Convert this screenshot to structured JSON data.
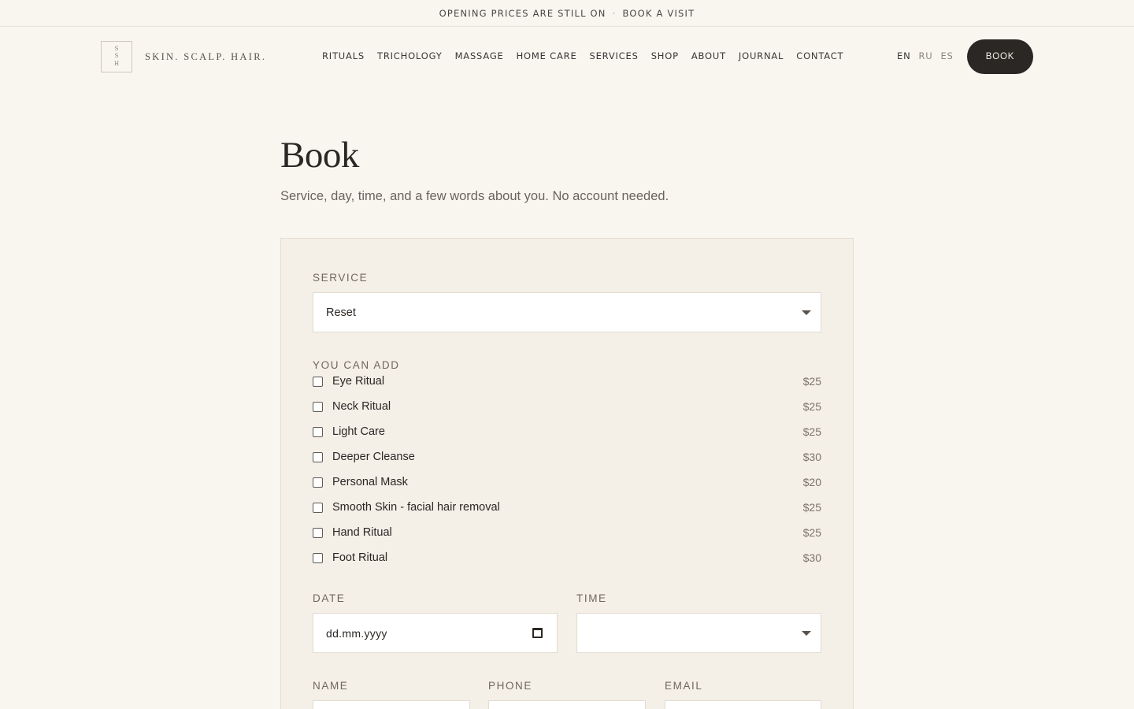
{
  "announcement": {
    "text": "OPENING PRICES ARE STILL ON",
    "separator": "·",
    "link": "BOOK A VISIT"
  },
  "brand": {
    "mark_lines": [
      "S",
      "S",
      "H"
    ],
    "name": "SKIN. SCALP. HAIR."
  },
  "nav": {
    "items": [
      "RITUALS",
      "TRICHOLOGY",
      "MASSAGE",
      "HOME CARE",
      "SERVICES",
      "SHOP",
      "ABOUT",
      "JOURNAL",
      "CONTACT"
    ]
  },
  "langs": {
    "items": [
      "EN",
      "RU",
      "ES"
    ],
    "active": "EN"
  },
  "header": {
    "book_label": "BOOK"
  },
  "page": {
    "title": "Book",
    "subtitle": "Service, day, time, and a few words about you. No account needed."
  },
  "form": {
    "service_label": "SERVICE",
    "service_value": "Reset",
    "addons_label": "YOU CAN ADD",
    "addons": [
      {
        "name": "Eye Ritual",
        "price": "$25",
        "checked": false
      },
      {
        "name": "Neck Ritual",
        "price": "$25",
        "checked": false
      },
      {
        "name": "Light Care",
        "price": "$25",
        "checked": false
      },
      {
        "name": "Deeper Cleanse",
        "price": "$30",
        "checked": false
      },
      {
        "name": "Personal Mask",
        "price": "$20",
        "checked": false
      },
      {
        "name": "Smooth Skin - facial hair removal",
        "price": "$25",
        "checked": false
      },
      {
        "name": "Hand Ritual",
        "price": "$25",
        "checked": false
      },
      {
        "name": "Foot Ritual",
        "price": "$30",
        "checked": false
      }
    ],
    "date_label": "DATE",
    "date_placeholder": "dd.mm.yyyy",
    "time_label": "TIME",
    "time_value": "",
    "name_label": "NAME",
    "phone_label": "PHONE",
    "email_label": "EMAIL"
  }
}
